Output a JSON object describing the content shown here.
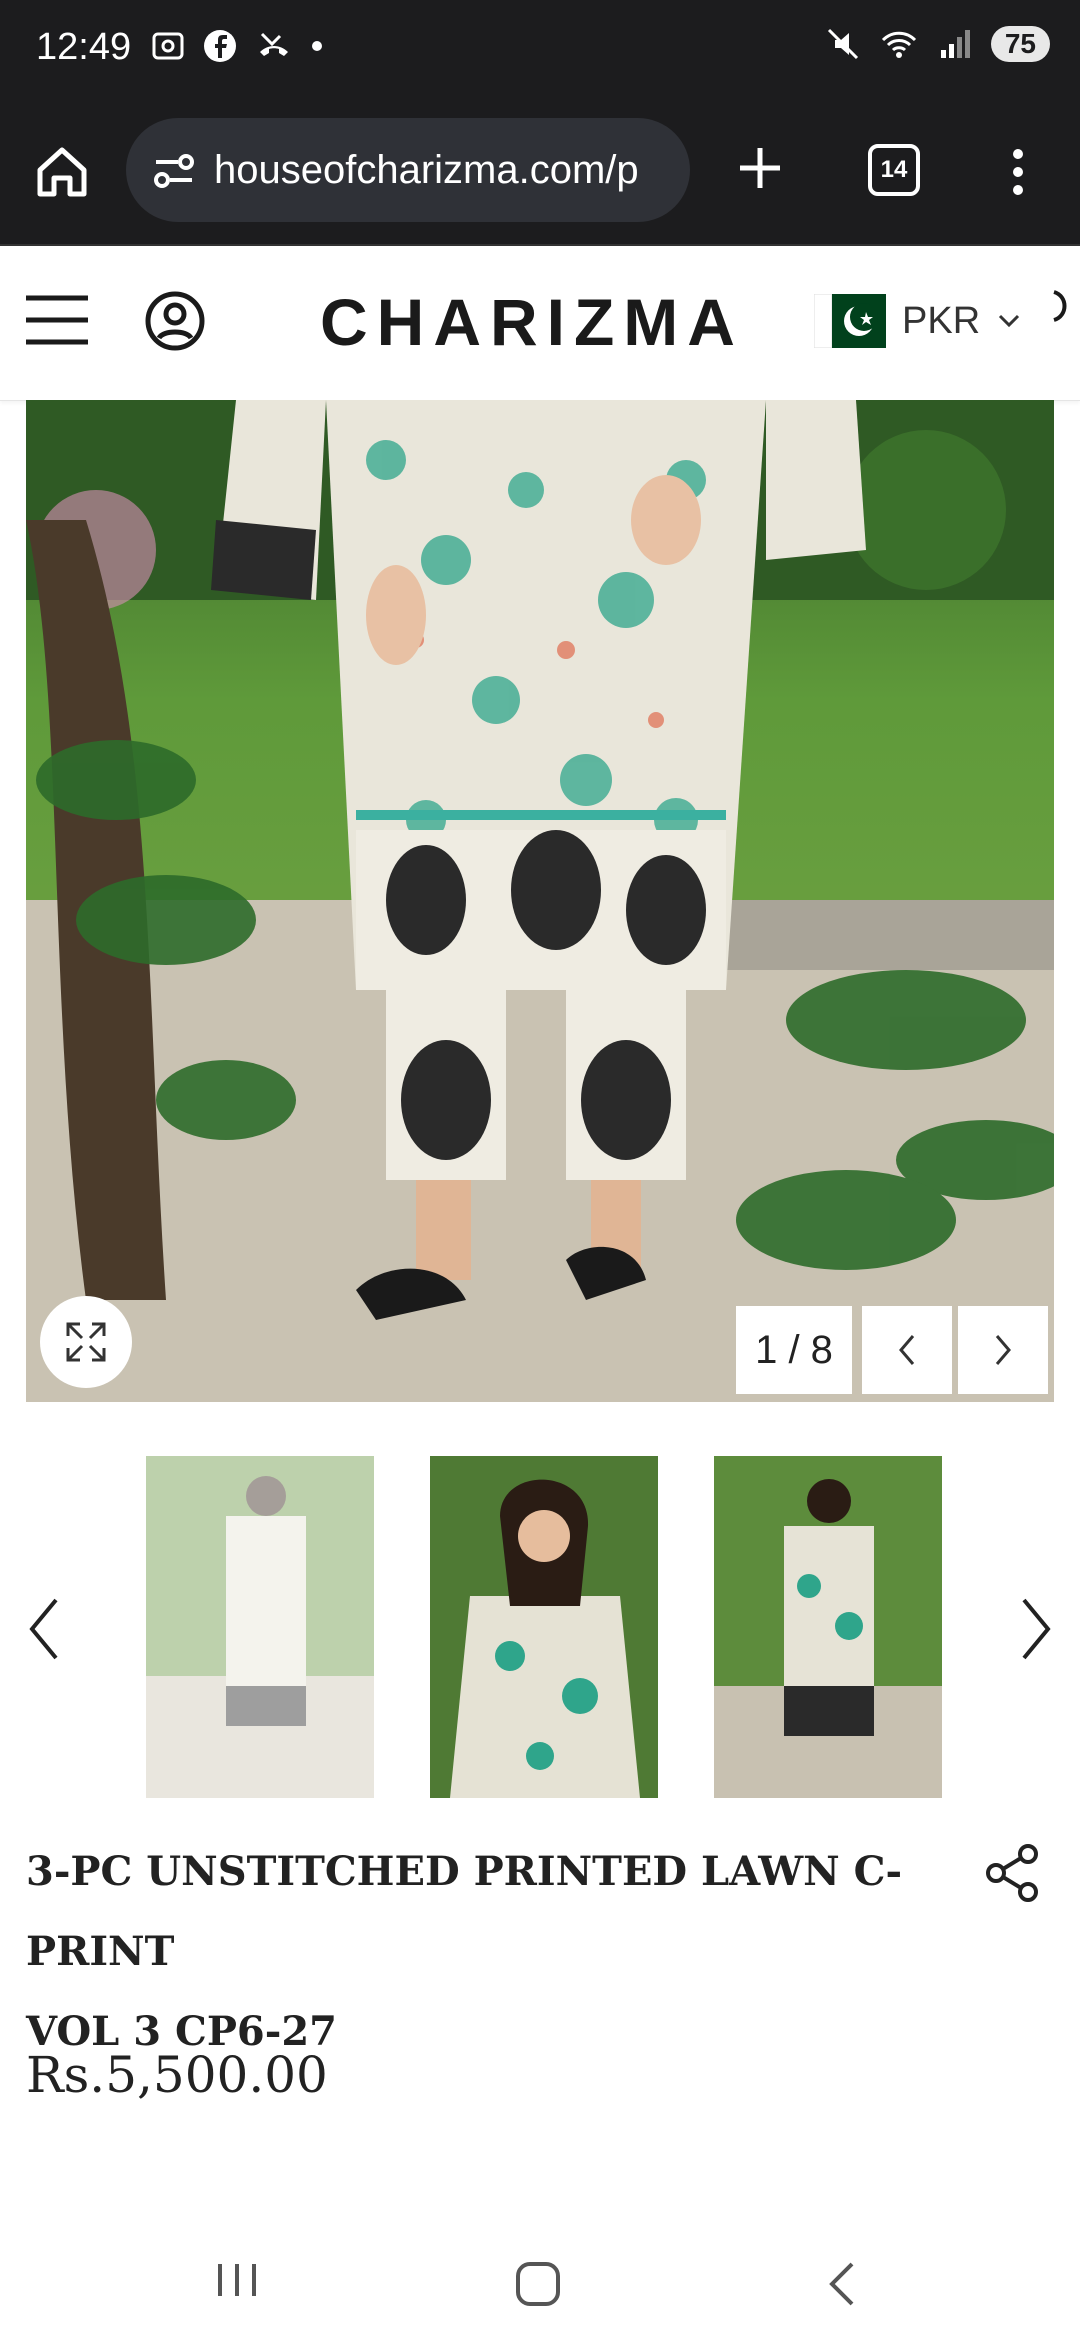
{
  "status_bar": {
    "time": "12:49",
    "left_icons": [
      "screenshot-icon",
      "facebook-icon",
      "missed-call-icon",
      "dot-icon"
    ],
    "right_icons": [
      "mute-icon",
      "wifi-icon",
      "signal-icon"
    ],
    "battery": "75"
  },
  "browser": {
    "url": "houseofcharizma.com/p",
    "tab_count": "14"
  },
  "site": {
    "logo": "CHARIZMA",
    "currency": "PKR"
  },
  "gallery": {
    "counter": "1 / 8"
  },
  "product": {
    "title_line1": "3-PC UNSTITCHED PRINTED LAWN C-PRINT",
    "title_line2": "VOL 3 CP6-27",
    "price": "Rs.5,500.00"
  },
  "colors": {
    "status_bg": "#1c1c1e",
    "url_bg": "#2f3137",
    "flag_green": "#01411c"
  }
}
